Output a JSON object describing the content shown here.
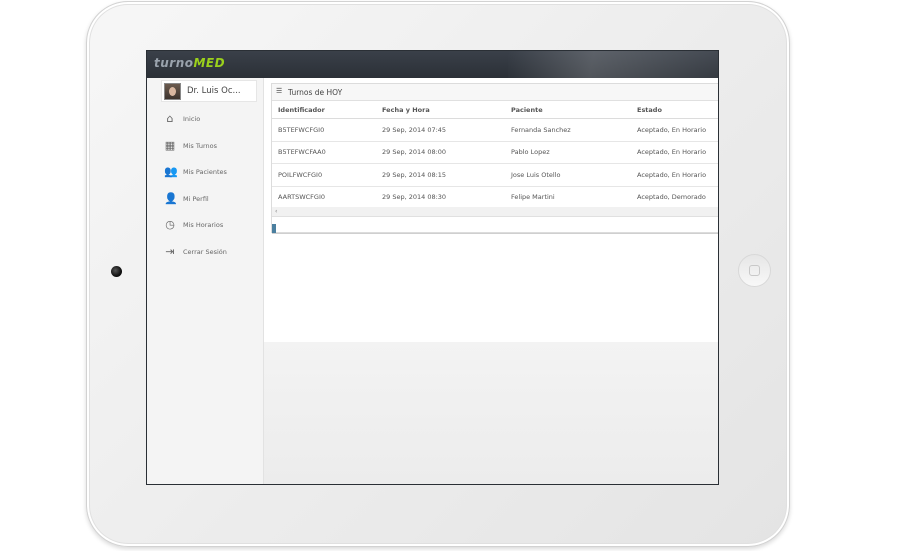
{
  "app": {
    "logo_part1": "turno",
    "logo_part2": "MED"
  },
  "user": {
    "name": "Dr. Luis Oc..."
  },
  "sidebar": {
    "items": [
      {
        "label": "Inicio",
        "icon": "home-icon",
        "glyph": "⌂"
      },
      {
        "label": "Mis Turnos",
        "icon": "calendar-icon",
        "glyph": "▦"
      },
      {
        "label": "Mis Pacientes",
        "icon": "users-icon",
        "glyph": "👥"
      },
      {
        "label": "Mi Perfil",
        "icon": "user-profile-icon",
        "glyph": "👤"
      },
      {
        "label": "Mis Horarios",
        "icon": "clock-icon",
        "glyph": "◷"
      },
      {
        "label": "Cerrar Sesión",
        "icon": "logout-icon",
        "glyph": "⇥"
      }
    ]
  },
  "panel": {
    "title": "Turnos de HOY",
    "icon": "list-icon"
  },
  "table": {
    "columns": [
      "Identificador",
      "Fecha y Hora",
      "Paciente",
      "Estado"
    ],
    "rows": [
      {
        "id": "B5TEFWCFGI0",
        "fecha": "29 Sep, 2014 07:45",
        "paciente": "Fernanda Sanchez",
        "estado": "Aceptado, En Horario"
      },
      {
        "id": "B5TEFWCFAA0",
        "fecha": "29 Sep, 2014 08:00",
        "paciente": "Pablo Lopez",
        "estado": "Aceptado, En Horario"
      },
      {
        "id": "POILFWCFGI0",
        "fecha": "29 Sep, 2014 08:15",
        "paciente": "Jose Luis Otello",
        "estado": "Aceptado, En Horario"
      },
      {
        "id": "AARTSWCFGI0",
        "fecha": "29 Sep, 2014 08:30",
        "paciente": "Felipe Martini",
        "estado": "Aceptado, Demorado"
      }
    ]
  },
  "scrollbar": {
    "left_arrow": "‹"
  }
}
